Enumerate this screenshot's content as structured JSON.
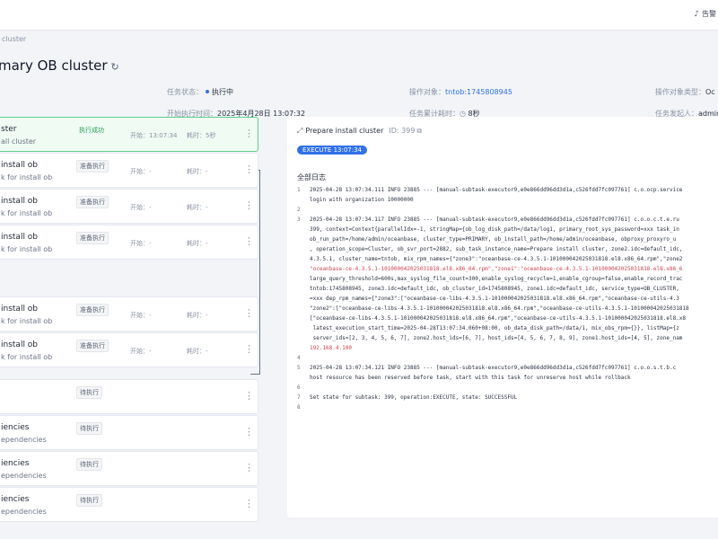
{
  "topbar": {
    "right_text": "告警"
  },
  "breadcrumb": "cluster",
  "title": "mary OB cluster",
  "meta": {
    "status_label": "任务状态：",
    "status_value": "执行中",
    "target_label": "操作对象：",
    "target_value": "tntob:1745808945",
    "optype_label": "操作对象类型：",
    "optype_value": "Oc",
    "start_label": "开始执行时间：",
    "start_value": "2025年4月28日 13:07:32",
    "elapsed_label": "任务累计耗时：",
    "elapsed_value": "8秒",
    "initiator_label": "任务发起人：",
    "initiator_value": "admin"
  },
  "subtasks": [
    {
      "name": "ster",
      "desc": "all cluster",
      "status": "执行成功",
      "start": "开始：13:07:34",
      "cost": "耗时：5秒"
    },
    {
      "name": "install ob",
      "desc": "k for install ob",
      "status": "准备执行",
      "start": "开始：-",
      "cost": "耗时：-"
    },
    {
      "name": "install ob",
      "desc": "k for install ob",
      "status": "准备执行",
      "start": "开始：-",
      "cost": "耗时：-"
    },
    {
      "name": "install ob",
      "desc": "k for install ob",
      "status": "准备执行",
      "start": "开始：-",
      "cost": "耗时：-"
    },
    {
      "name": "install ob",
      "desc": "k for install ob",
      "status": "准备执行",
      "start": "开始：-",
      "cost": "耗时：-"
    },
    {
      "name": "install ob",
      "desc": "k for install ob",
      "status": "准备执行",
      "start": "开始：-",
      "cost": "耗时：-"
    },
    {
      "name": "",
      "desc": "",
      "status": "待执行",
      "start": "",
      "cost": ""
    },
    {
      "name": "iencies",
      "desc": "ependencies",
      "status": "待执行",
      "start": "",
      "cost": ""
    },
    {
      "name": "iencies",
      "desc": "ependencies",
      "status": "待执行",
      "start": "",
      "cost": ""
    },
    {
      "name": "iencies",
      "desc": "ependencies",
      "status": "待执行",
      "start": "",
      "cost": ""
    }
  ],
  "detail": {
    "heading": "Prepare install cluster",
    "id_text": "ID: 399",
    "exec_tag": "EXECUTE 13:07:34",
    "log_title": "全部日志",
    "log_lines": [
      {
        "n": "1",
        "text": "2025-04-28 13:07:34.111  INFO 23885 --- [manual-subtask-executor9,e0e866dd96dd3d1a,c526fdd7fc097761] c.o.ocp.service"
      },
      {
        "n": "",
        "text": "login with organization 10000000"
      },
      {
        "n": "2",
        "text": ""
      },
      {
        "n": "3",
        "text": "2025-04-28 13:07:34.117  INFO 23885 --- [manual-subtask-executor9,e0e866dd96dd3d1a,c526fdd7fc097761] c.o.o.c.t.e.ru"
      },
      {
        "n": "",
        "text": "399, context=Context{parallelIdx=-1, stringMap={ob_log_disk_path=/data/log1, primary_root_sys_password=xxx task_in"
      },
      {
        "n": "",
        "text": "ob_run_path=/home/admin/oceanbase, cluster_type=PRIMARY, ob_install_path=/home/admin/oceanbase, obproxy_proxyro_u"
      },
      {
        "n": "",
        "text": ", operation_scope=Cluster, ob_svr_port=2882, sub_task_instance_name=Prepare install cluster, zone2.idc=default_idc,"
      },
      {
        "n": "",
        "text": "4.3.5.1, cluster_name=tntob, mix_rpm_names={\"zone3\":\"oceanbase-ce-4.3.5.1-101000042025031818.el8.x86_64.rpm\",\"zone2"
      },
      {
        "n": "",
        "text": "\"oceanbase-ce-4.3.5.1-101000042025031818.el8.x86_64.rpm\",\"zone1\":\"oceanbase-ce-4.3.5.1-101000042025031818.el8.x86_6"
      },
      {
        "n": "",
        "text": "large_query_threshold=600s,max_syslog_file_count=300,enable_syslog_recycle=1,enable_cgroup=false,enable_record_trac"
      },
      {
        "n": "",
        "text": "tntob:1745808945, zone3.idc=default_idc, ob_cluster_id=1745808945, zone1.idc=default_idc, service_type=OB_CLUSTER,"
      },
      {
        "n": "",
        "text": "=xxx dep_rpm_names={\"zone3\":[\"oceanbase-ce-libs-4.3.5.1-101000042025031818.el8.x86_64.rpm\",\"oceanbase-ce-utils-4.3"
      },
      {
        "n": "",
        "text": "\"zone2\":[\"oceanbase-ce-libs-4.3.5.1-101000042025031818.el8.x86_64.rpm\",\"oceanbase-ce-utils-4.3.5.1-101000042025031818"
      },
      {
        "n": "",
        "text": "[\"oceanbase-ce-libs-4.3.5.1-101000042025031818.el8.x86_64.rpm\",\"oceanbase-ce-utils-4.3.5.1-101000042025031818.el8.x8"
      },
      {
        "n": "",
        "text": " latest_execution_start_time=2025-04-28T13:07:34.060+08:00, ob_data_disk_path=/data/1, mix_obs_rpm={}}, listMap={z"
      },
      {
        "n": "",
        "text": " server_ids=[2, 3, 4, 5, 6, 7], zone2.host_ids=[6, 7], host_ids=[4, 5, 6, 7, 8, 9], zone1.host_ids=[4, 5], zone_nam"
      },
      {
        "n": "",
        "text": "192.168.4.100"
      },
      {
        "n": "4",
        "text": ""
      },
      {
        "n": "5",
        "text": "2025-04-28 13:07:34.121  INFO 23885 --- [manual-subtask-executor9,e0e866dd96dd3d1a,c526fdd7fc097761] c.o.o.s.t.b.c"
      },
      {
        "n": "",
        "text": "host resource has been reserved before task, start with this task for unreserve host while rollback"
      },
      {
        "n": "6",
        "text": ""
      },
      {
        "n": "7",
        "text": "Set state for subtask: 399, operation:EXECUTE, state: SUCCESSFUL"
      },
      {
        "n": "8",
        "text": ""
      }
    ]
  },
  "colors": {
    "accent": "#3171e8",
    "success": "#1e9e55",
    "error_red": "#d0424f"
  },
  "icons": [
    "bell-icon",
    "refresh-icon",
    "more-icon",
    "expand-icon",
    "copy-icon"
  ]
}
